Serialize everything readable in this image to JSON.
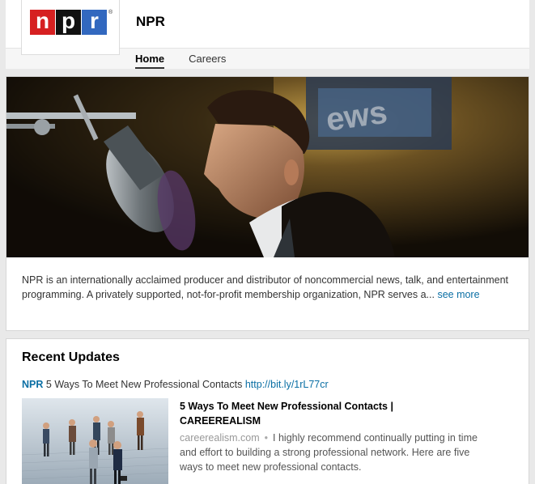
{
  "company": {
    "name": "NPR",
    "logo_letters": [
      "n",
      "p",
      "r"
    ],
    "logo_colors": [
      "#d62021",
      "#111111",
      "#3268bf"
    ],
    "logo_mark": "®"
  },
  "tabs": [
    {
      "label": "Home",
      "active": true
    },
    {
      "label": "Careers",
      "active": false
    }
  ],
  "about": {
    "text": "NPR is an internationally acclaimed producer and distributor of noncommercial news, talk, and entertainment programming. A privately supported, not-for-profit membership organization, NPR serves a...",
    "see_more": "see more"
  },
  "updates": {
    "title": "Recent Updates",
    "items": [
      {
        "author": "NPR",
        "text": "5 Ways To Meet New Professional Contacts",
        "link": "http://bit.ly/1rL77cr",
        "article_title": "5 Ways To Meet New Professional Contacts | CAREEREALISM",
        "domain": "careerealism.com",
        "separator": "•",
        "description": "I highly recommend continually putting in time and effort to building a strong professional network. Here are five ways to meet new professional contacts."
      }
    ]
  },
  "colors": {
    "link": "#0b6fa4",
    "page_bg": "#e9e9e9"
  }
}
